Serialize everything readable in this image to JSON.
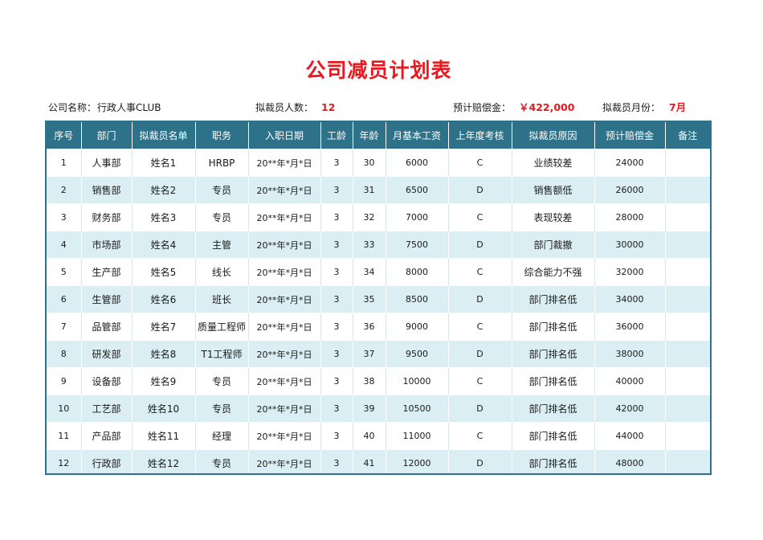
{
  "title": "公司减员计划表",
  "info": {
    "company_label": "公司名称：",
    "company_value": "行政人事CLUB",
    "count_label": "拟裁员人数：",
    "count_value": "12",
    "comp_label": "预计赔偿金：",
    "comp_value": "￥422,000",
    "month_label": "拟裁员月份：",
    "month_value": "7月"
  },
  "table": {
    "headers": [
      "序号",
      "部门",
      "拟裁员名单",
      "职务",
      "入职日期",
      "工龄",
      "年龄",
      "月基本工资",
      "上年度考核",
      "拟裁员原因",
      "预计赔偿金",
      "备注"
    ],
    "rows": [
      [
        "1",
        "人事部",
        "姓名1",
        "HRBP",
        "20**年*月*日",
        "3",
        "30",
        "6000",
        "C",
        "业绩较差",
        "24000",
        ""
      ],
      [
        "2",
        "销售部",
        "姓名2",
        "专员",
        "20**年*月*日",
        "3",
        "31",
        "6500",
        "D",
        "销售额低",
        "26000",
        ""
      ],
      [
        "3",
        "财务部",
        "姓名3",
        "专员",
        "20**年*月*日",
        "3",
        "32",
        "7000",
        "C",
        "表现较差",
        "28000",
        ""
      ],
      [
        "4",
        "市场部",
        "姓名4",
        "主管",
        "20**年*月*日",
        "3",
        "33",
        "7500",
        "D",
        "部门裁撤",
        "30000",
        ""
      ],
      [
        "5",
        "生产部",
        "姓名5",
        "线长",
        "20**年*月*日",
        "3",
        "34",
        "8000",
        "C",
        "综合能力不强",
        "32000",
        ""
      ],
      [
        "6",
        "生管部",
        "姓名6",
        "班长",
        "20**年*月*日",
        "3",
        "35",
        "8500",
        "D",
        "部门排名低",
        "34000",
        ""
      ],
      [
        "7",
        "品管部",
        "姓名7",
        "质量工程师",
        "20**年*月*日",
        "3",
        "36",
        "9000",
        "C",
        "部门排名低",
        "36000",
        ""
      ],
      [
        "8",
        "研发部",
        "姓名8",
        "T1工程师",
        "20**年*月*日",
        "3",
        "37",
        "9500",
        "D",
        "部门排名低",
        "38000",
        ""
      ],
      [
        "9",
        "设备部",
        "姓名9",
        "专员",
        "20**年*月*日",
        "3",
        "38",
        "10000",
        "C",
        "部门排名低",
        "40000",
        ""
      ],
      [
        "10",
        "工艺部",
        "姓名10",
        "专员",
        "20**年*月*日",
        "3",
        "39",
        "10500",
        "D",
        "部门排名低",
        "42000",
        ""
      ],
      [
        "11",
        "产品部",
        "姓名11",
        "经理",
        "20**年*月*日",
        "3",
        "40",
        "11000",
        "C",
        "部门排名低",
        "44000",
        ""
      ],
      [
        "12",
        "行政部",
        "姓名12",
        "专员",
        "20**年*月*日",
        "3",
        "41",
        "12000",
        "D",
        "部门排名低",
        "48000",
        ""
      ]
    ]
  },
  "colors": {
    "title_red": "#e8181e",
    "header_teal": "#2e7289",
    "band_light_blue": "#daeef3"
  }
}
